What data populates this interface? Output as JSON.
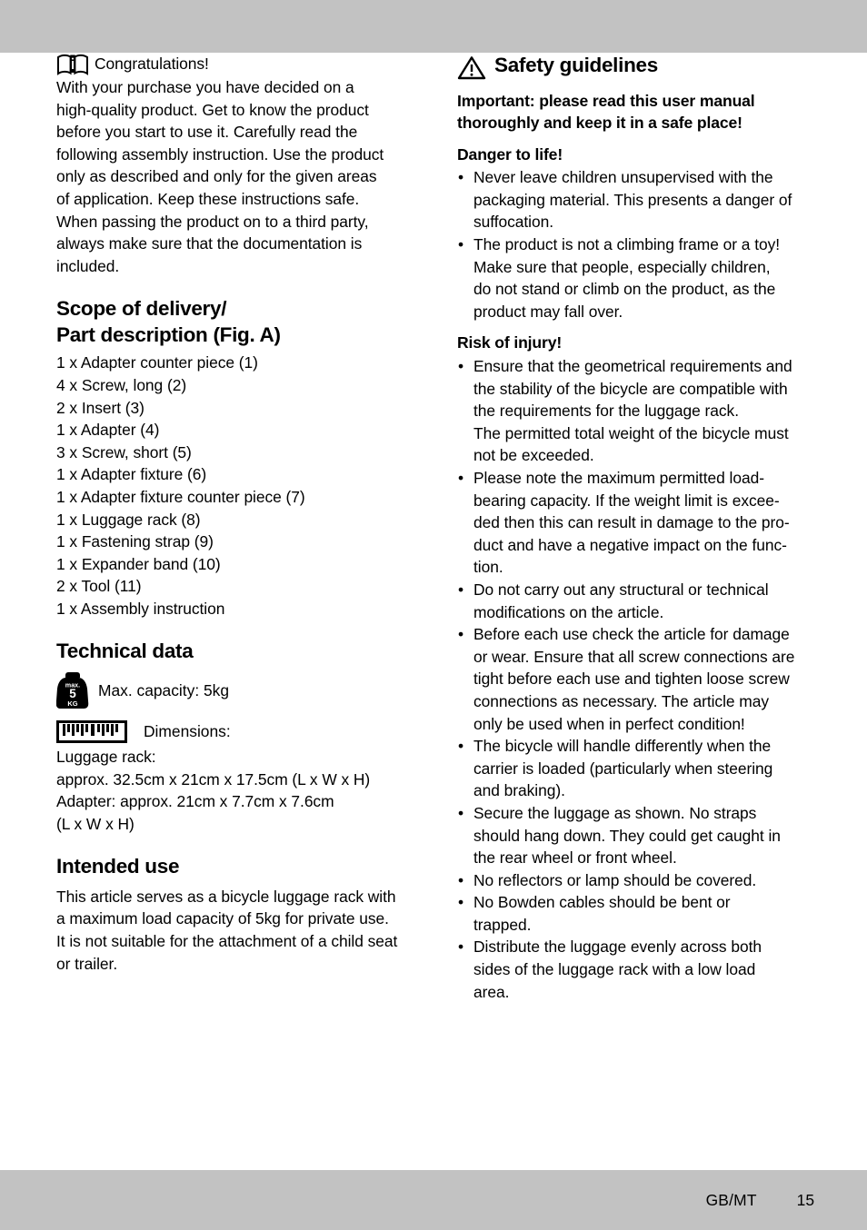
{
  "page": {
    "footer_label": "GB/MT",
    "footer_page": "15",
    "band_color": "#c2c2c2"
  },
  "left_column": {
    "intro": {
      "icon": "book-info-icon",
      "headline": "Congratulations!",
      "lines": [
        "With your purchase you have decided on a",
        "high-quality product. Get to know the product",
        "before you start to use it. Carefully read the",
        "following assembly instruction. Use the product",
        "only as described and only for the given areas",
        "of application. Keep these instructions safe.",
        "When passing the product on to a third party,",
        "always make sure that the documentation is",
        "included."
      ]
    },
    "scope": {
      "title_line1": "Scope of delivery/",
      "title_line2": "Part description (Fig. A)",
      "items": [
        "1 x Adapter counter piece (1)",
        "4 x Screw, long (2)",
        "2 x Insert (3)",
        "1 x Adapter (4)",
        "3 x Screw, short (5)",
        "1 x Adapter fixture (6)",
        "1 x Adapter fixture counter piece (7)",
        "1 x Luggage rack (8)",
        "1 x Fastening strap (9)",
        "1 x Expander band (10)",
        "2 x Tool (11)",
        "1 x Assembly instruction"
      ]
    },
    "technical": {
      "title": "Technical data",
      "weight_icon": {
        "name": "max-weight-icon",
        "top_text": "max.",
        "value": "5",
        "unit": "KG"
      },
      "capacity_label": "Max. capacity: 5kg",
      "ruler_icon": "ruler-icon",
      "dimensions_label": "Dimensions:",
      "dimension_lines": [
        "Luggage rack:",
        "approx. 32.5cm x 21cm x 17.5cm (L x W x H)",
        "Adapter: approx. 21cm x 7.7cm x 7.6cm",
        "(L x W x H)"
      ]
    },
    "intended_use": {
      "title": "Intended use",
      "lines": [
        "This article serves as a bicycle luggage rack with",
        "a maximum load capacity of 5kg for private use.",
        "It is not suitable for the attachment of a child seat",
        "or trailer."
      ]
    }
  },
  "right_column": {
    "safety": {
      "icon": "warning-triangle-icon",
      "title": "Safety guidelines",
      "important_line1": "Important: please read this user manual",
      "important_line2": "thoroughly and keep it in a safe place!"
    },
    "danger_to_life": {
      "title": "Danger to life!",
      "bullets": [
        [
          "Never leave children unsupervised with the",
          "packaging material. This presents a danger of",
          "suffocation."
        ],
        [
          "The product is not a climbing frame or a toy!",
          "Make sure that people, especially children,",
          "do not stand or climb on the product, as the",
          "product may fall over."
        ]
      ]
    },
    "risk_of_injury": {
      "title": "Risk of injury!",
      "bullets": [
        [
          "Ensure that the geometrical requirements and",
          "the stability of the bicycle are compatible with",
          "the requirements for the luggage rack.",
          "The permitted total weight of the bicycle must",
          "not be exceeded."
        ],
        [
          "Please note the maximum permitted load-",
          "bearing capacity. If the weight limit is excee-",
          "ded then this can result in damage to the pro-",
          "duct and have a negative impact on the func-",
          "tion."
        ],
        [
          "Do not carry out any structural or technical",
          "modifications on the article."
        ],
        [
          "Before each use check the article for damage",
          "or wear. Ensure that all screw connections are",
          "tight before each use and tighten loose screw",
          "connections as necessary. The article may",
          "only be used when in perfect condition!"
        ],
        [
          "The bicycle will handle differently when the",
          "carrier is loaded (particularly when steering",
          "and braking)."
        ],
        [
          "Secure the luggage as shown. No straps",
          "should hang down. They could get caught in",
          "the rear wheel or front wheel."
        ],
        [
          "No reflectors or lamp should be covered."
        ],
        [
          "No Bowden cables should be bent or",
          "trapped."
        ],
        [
          "Distribute the luggage evenly across both",
          "sides of the luggage rack with a low load",
          "area."
        ]
      ]
    }
  }
}
